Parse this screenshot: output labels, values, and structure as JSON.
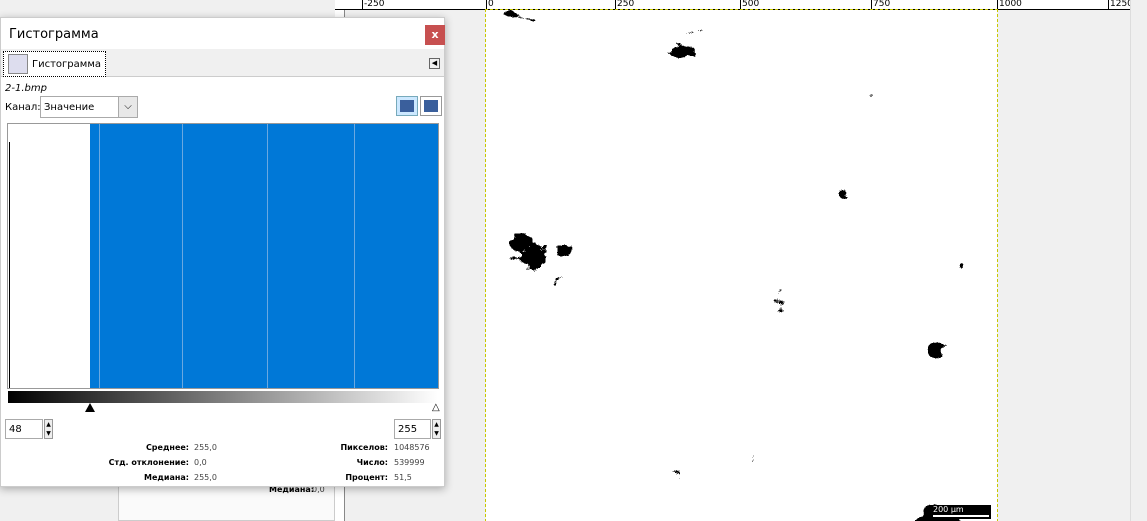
{
  "ruler": {
    "ticks": [
      "-250",
      "0",
      "250",
      "500",
      "750",
      "1000",
      "1250"
    ]
  },
  "image": {
    "scale_label": "200 µm"
  },
  "dialog": {
    "title": "Гистограмма",
    "close": "x",
    "tab_label": "Гистограмма",
    "filename": "2-1.bmp",
    "channel_label": "Канал:",
    "channel_value": "Значение",
    "range_min": "48",
    "range_max": "255",
    "stats": {
      "mean_label": "Среднее:",
      "mean": "255,0",
      "std_label": "Стд. отклонение:",
      "std": "0,0",
      "median_label": "Медиана:",
      "median": "255,0",
      "pixels_label": "Пикселов:",
      "pixels": "1048576",
      "count_label": "Число:",
      "count": "539999",
      "percent_label": "Процент:",
      "percent": "51,5"
    }
  },
  "back_window": {
    "median_label": "Медиана:",
    "median": "0,0"
  },
  "colors": {
    "histogram": "#0078d7",
    "close": "#c75050"
  }
}
